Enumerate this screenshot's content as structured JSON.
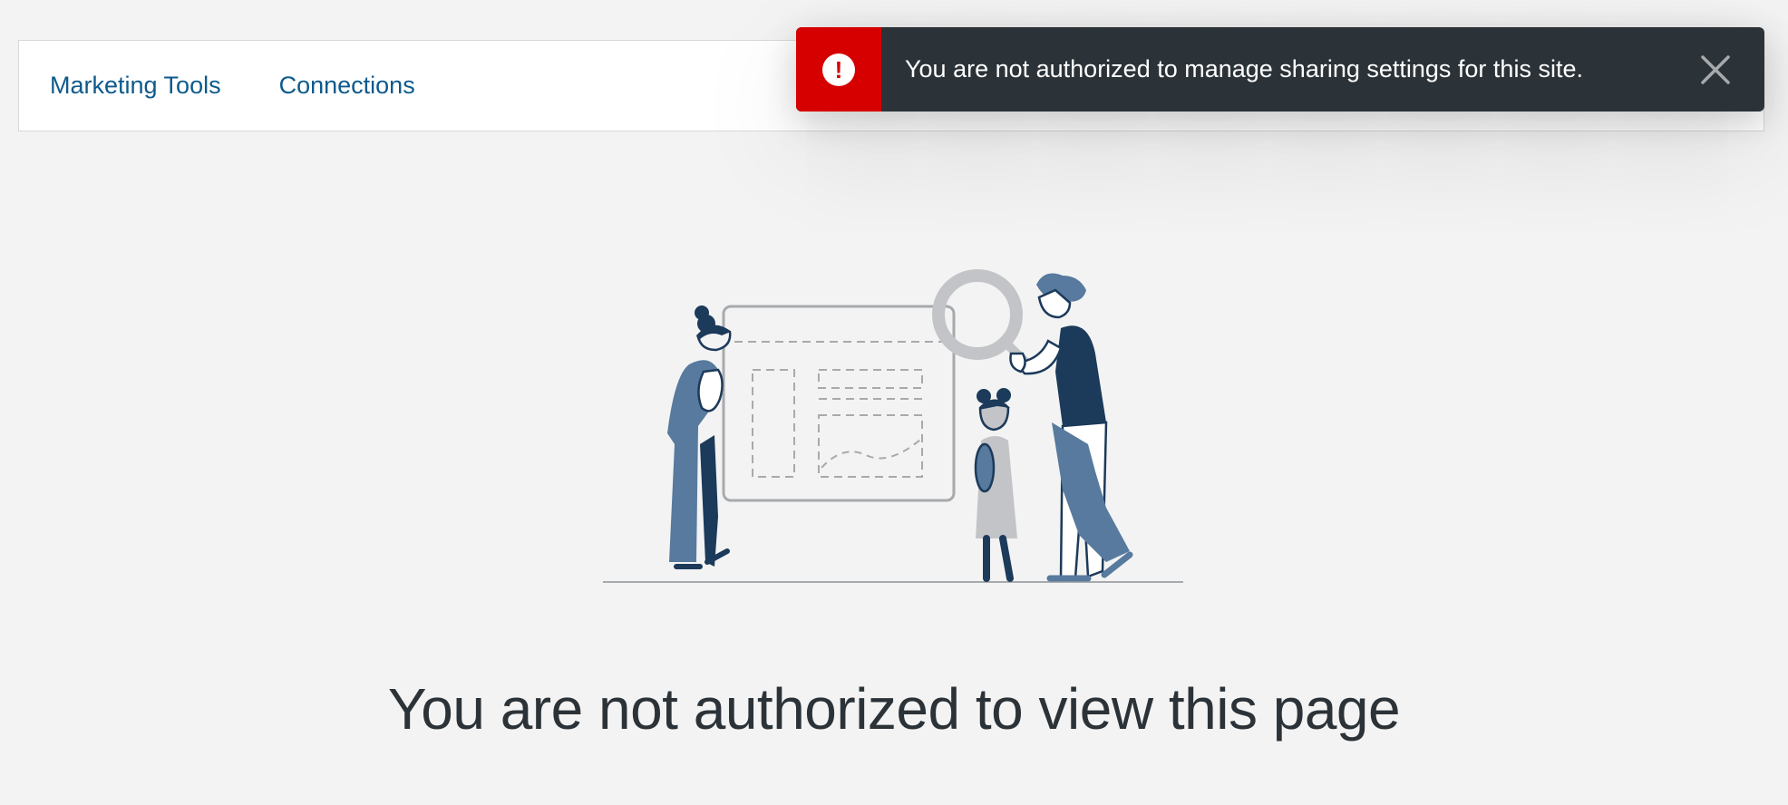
{
  "section_nav": {
    "tabs": [
      {
        "label": "Marketing Tools"
      },
      {
        "label": "Connections"
      }
    ]
  },
  "notice": {
    "status": "error",
    "icon": "alert-icon",
    "icon_glyph": "!",
    "message": "You are not authorized to manage sharing settings for this site.",
    "close_icon": "close-icon"
  },
  "empty_content": {
    "illustration": "people-looking-at-board-illustration",
    "title": "You are not authorized to view this page"
  },
  "colors": {
    "background": "#f3f3f3",
    "tab_link": "#0d5a8c",
    "notice_bg": "#2c3338",
    "error_red": "#d60000",
    "title_text": "#2c3338"
  }
}
